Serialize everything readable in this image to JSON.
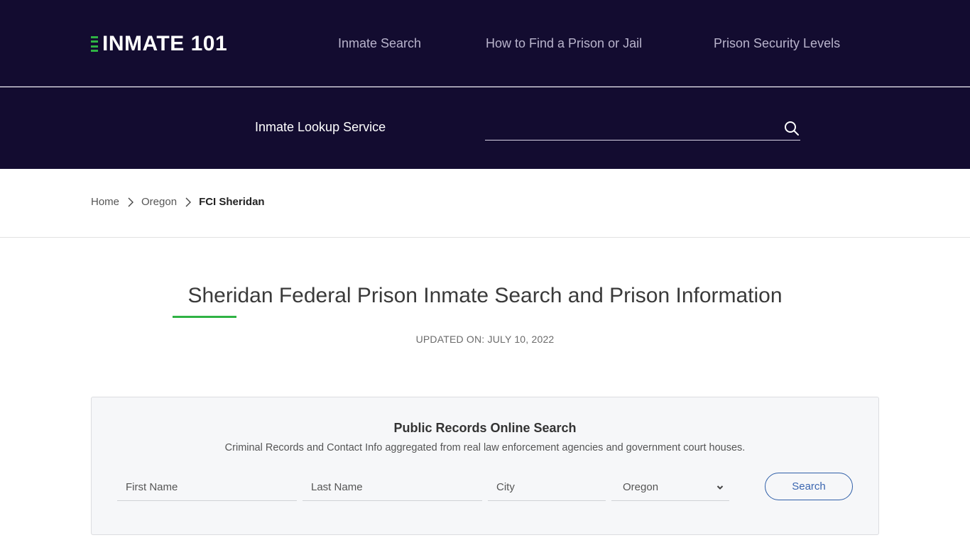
{
  "header": {
    "logo_text": "INMATE 101",
    "nav": [
      {
        "label": "Inmate Search"
      },
      {
        "label": "How to Find a Prison or Jail"
      },
      {
        "label": "Prison Security Levels"
      }
    ]
  },
  "lookup": {
    "label": "Inmate Lookup Service",
    "input_value": "",
    "icon": "search-icon"
  },
  "breadcrumb": {
    "items": [
      {
        "label": "Home"
      },
      {
        "label": "Oregon"
      }
    ],
    "current": "FCI Sheridan"
  },
  "main": {
    "title": "Sheridan Federal Prison Inmate Search and Prison Information",
    "updated": "UPDATED ON: JULY 10, 2022"
  },
  "records": {
    "title": "Public Records Online Search",
    "subtitle": "Criminal Records and Contact Info aggregated from real law enforcement agencies and government court houses.",
    "fields": {
      "first_name": {
        "placeholder": "First Name",
        "value": ""
      },
      "last_name": {
        "placeholder": "Last Name",
        "value": ""
      },
      "city": {
        "placeholder": "City",
        "value": ""
      },
      "state": {
        "selected": "Oregon"
      }
    },
    "search_label": "Search"
  },
  "colors": {
    "header_bg": "#130c30",
    "accent_green": "#2fb344",
    "button_blue": "#2f5fa8"
  }
}
